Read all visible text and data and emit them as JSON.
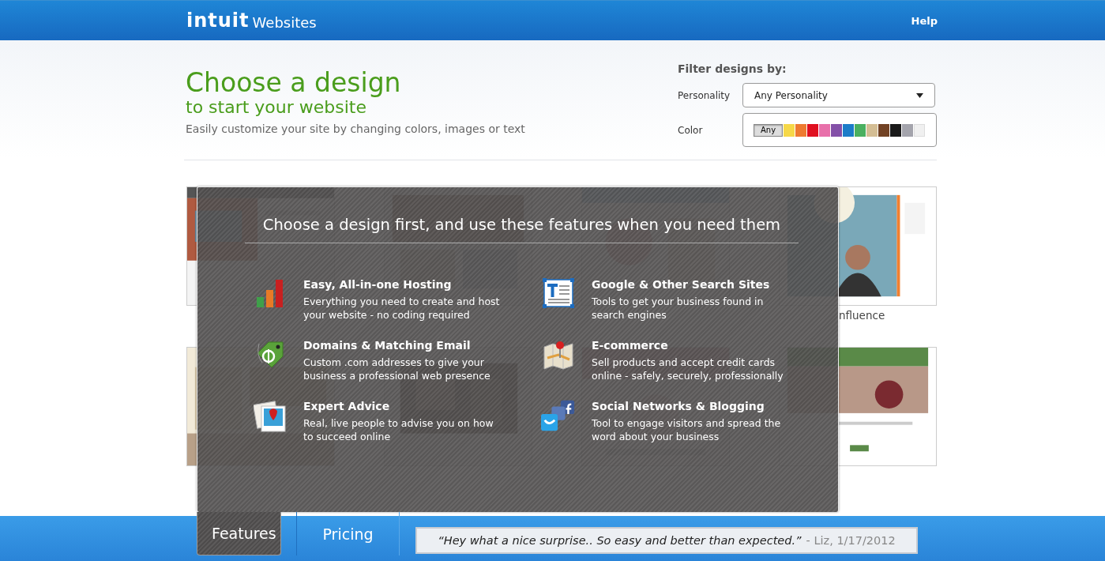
{
  "header": {
    "brand": "intuit",
    "product": "Websites",
    "help": "Help"
  },
  "intro": {
    "title": "Choose a design",
    "subtitle": "to start your website",
    "description": "Easily customize your site by changing colors, images or text"
  },
  "filter": {
    "heading": "Filter designs by:",
    "personality_label": "Personality",
    "personality_value": "Any Personality",
    "color_label": "Color",
    "any_button": {
      "label": "Any",
      "selected": true
    },
    "swatches": [
      {
        "color": "#f6d848",
        "selected": false
      },
      {
        "color": "#ee7a30",
        "selected": false
      },
      {
        "color": "#e01020",
        "selected": false
      },
      {
        "color": "#e870aa",
        "selected": false
      },
      {
        "color": "#8450a8",
        "selected": false
      },
      {
        "color": "#1c7cc8",
        "selected": false
      },
      {
        "color": "#4ab060",
        "selected": false
      },
      {
        "color": "#d4be94",
        "selected": false
      },
      {
        "color": "#724224",
        "selected": false
      },
      {
        "color": "#1a1a1a",
        "selected": false
      },
      {
        "color": "#a4a4ac",
        "selected": false
      },
      {
        "color": "#f0f0f0",
        "selected": false
      }
    ]
  },
  "designs": [
    {
      "kind": "picture"
    },
    {
      "kind": "picture"
    },
    {
      "kind": "picture"
    },
    {
      "kind": "picture",
      "label": "nfluence"
    },
    {
      "kind": "picture"
    },
    {
      "kind": "picture"
    },
    {
      "kind": "picture"
    },
    {
      "kind": "picture"
    }
  ],
  "features_panel": {
    "title": "Choose a design first, and use these features when you need them",
    "features": [
      {
        "kind": "hosting",
        "title": "Easy, All-in-one Hosting",
        "description": "Everything you need to create and host your website - no coding required"
      },
      {
        "kind": "search",
        "title": "Google & Other Search Sites",
        "description": "Tools to get your business found in search engines"
      },
      {
        "kind": "domains",
        "title": "Domains & Matching Email",
        "description": "Custom .com addresses to give your business a professional web presence"
      },
      {
        "kind": "ecommerce",
        "title": "E-commerce",
        "description": "Sell products and accept credit cards online - safely, securely, professionally"
      },
      {
        "kind": "advice",
        "title": "Expert Advice",
        "description": "Real, live people to advise you on how to succeed online"
      },
      {
        "kind": "social",
        "title": "Social Networks & Blogging",
        "description": "Tool to engage visitors and spread the word about your business"
      }
    ]
  },
  "bottom_bar": {
    "tabs": [
      {
        "label": "Features",
        "selected": true
      },
      {
        "label": "Pricing",
        "selected": false
      }
    ],
    "testimonial": {
      "quote": "“Hey what a nice surprise.. So easy and better than expected.”",
      "attribution": "- Liz, 1/17/2012"
    }
  }
}
